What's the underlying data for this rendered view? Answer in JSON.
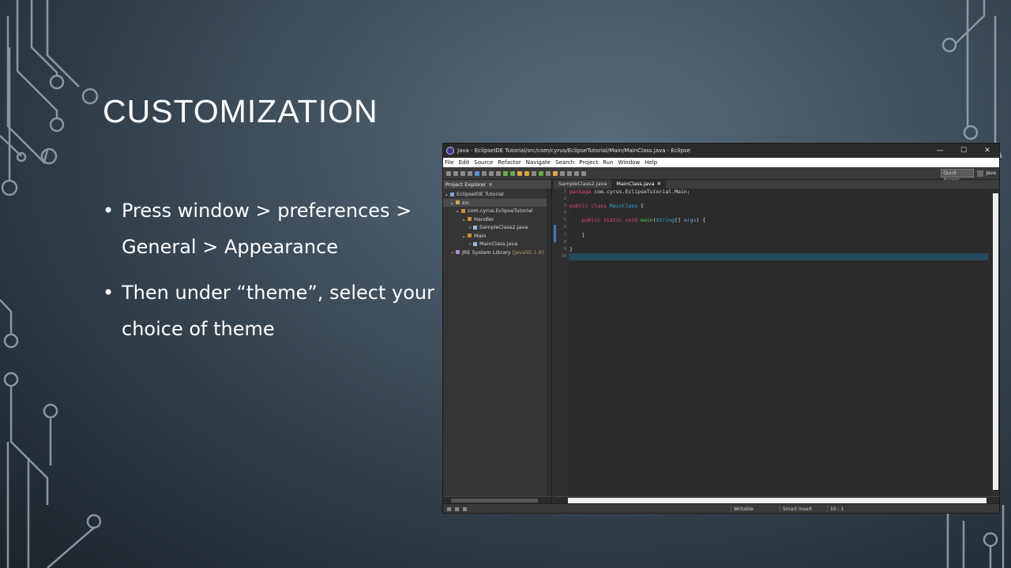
{
  "slide": {
    "title": "CUSTOMIZATION",
    "bullets": [
      "Press window > preferences > General > Appearance",
      "Then under “theme”, select your choice of theme"
    ]
  },
  "eclipse": {
    "window_title": "Java - EclipseIDE Tutorial/src/com/cyrus/EclipseTutorial/Main/MainClass.java - Eclipse",
    "window_controls": [
      "—",
      "☐",
      "✕"
    ],
    "menu": [
      "File",
      "Edit",
      "Source",
      "Refactor",
      "Navigate",
      "Search",
      "Project",
      "Run",
      "Window",
      "Help"
    ],
    "quick_access": "Quick Access",
    "perspective": "Java",
    "explorer": {
      "tab_label": "Project Explorer",
      "close": "✕",
      "tree": [
        {
          "twisty": "▴",
          "icon": "proj",
          "label": "EclipseIDE Tutorial",
          "extra": ""
        },
        {
          "twisty": "▴",
          "icon": "folder",
          "label": "src",
          "extra": ""
        },
        {
          "twisty": "▴",
          "icon": "pkg",
          "label": "com.cyrus.EclipseTutorial",
          "extra": ""
        },
        {
          "twisty": "▴",
          "icon": "pkg",
          "label": "Handler",
          "extra": ""
        },
        {
          "twisty": ">",
          "icon": "file",
          "label": "SampleClass2.java",
          "extra": ""
        },
        {
          "twisty": "▴",
          "icon": "pkg",
          "label": "Main",
          "extra": ""
        },
        {
          "twisty": ">",
          "icon": "file",
          "label": "MainClass.java",
          "extra": ""
        },
        {
          "twisty": ">",
          "icon": "lib",
          "label": "JRE System Library",
          "extra": "[JavaSE-1.8]"
        }
      ]
    },
    "editor": {
      "tabs": [
        "SampleClass2.java",
        "MainClass.java"
      ],
      "close": "✕",
      "line_numbers": [
        "1",
        "2",
        "3",
        "4",
        "5",
        "6",
        "7",
        "8",
        "9",
        "10"
      ],
      "code": [
        [
          {
            "t": "package",
            "c": "kw"
          },
          {
            "t": " com.cyrus.EclipseTutorial.Main;",
            "c": ""
          }
        ],
        [],
        [
          {
            "t": "public class",
            "c": "kw"
          },
          {
            "t": " ",
            "c": ""
          },
          {
            "t": "MainClass",
            "c": "cls"
          },
          {
            "t": " {",
            "c": ""
          }
        ],
        [],
        [
          {
            "t": "    ",
            "c": ""
          },
          {
            "t": "public static void",
            "c": "kw"
          },
          {
            "t": " ",
            "c": ""
          },
          {
            "t": "main",
            "c": "fn"
          },
          {
            "t": "(",
            "c": ""
          },
          {
            "t": "String",
            "c": "cls"
          },
          {
            "t": "[] ",
            "c": ""
          },
          {
            "t": "args",
            "c": "arg"
          },
          {
            "t": ") {",
            "c": ""
          }
        ],
        [],
        [
          {
            "t": "    }",
            "c": ""
          }
        ],
        [],
        [
          {
            "t": "}",
            "c": ""
          }
        ],
        []
      ],
      "current_line": 10
    },
    "status": {
      "writable": "Writable",
      "insert_mode": "Smart Insert",
      "position": "10 : 1"
    }
  }
}
